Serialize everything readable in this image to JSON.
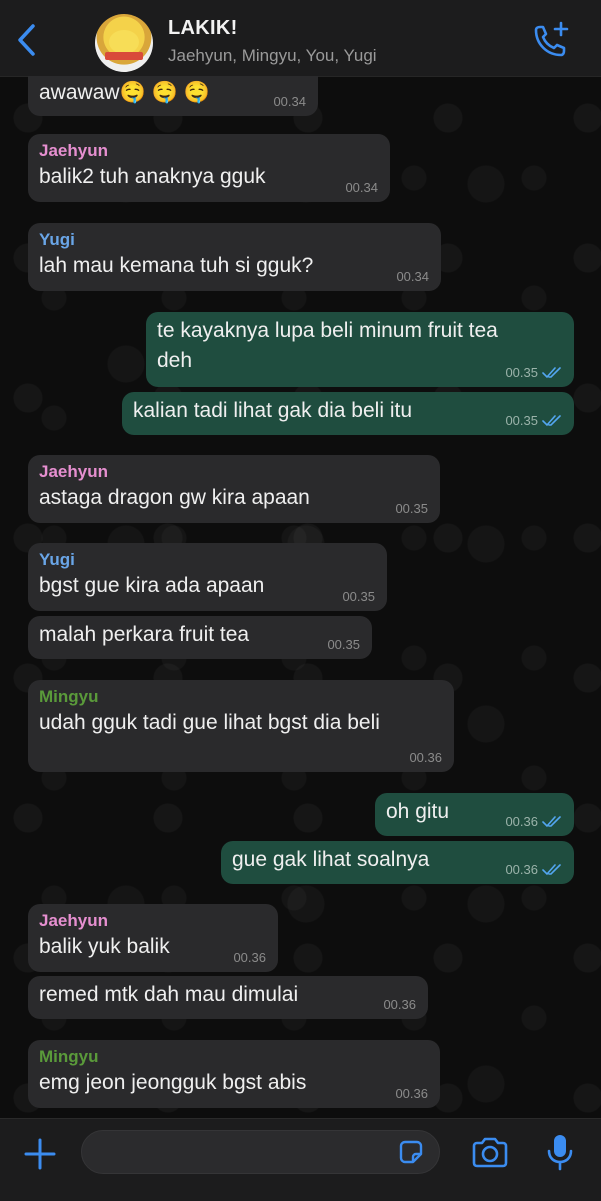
{
  "header": {
    "title": "LAKIK!",
    "members": "Jaehyun, Mingyu, You, Yugi",
    "back_icon": "chevron-left-icon",
    "call_icon": "phone-add-icon"
  },
  "colors": {
    "accent": "#3b8cf0",
    "jaehyun": "#e68fd0",
    "yugi": "#6aa6e8",
    "mingyu": "#5a9a3a",
    "outgoing_bubble": "#1f4d3f",
    "incoming_bubble": "#2a2a2c",
    "read_ticks": "#53a6f0"
  },
  "messages": [
    {
      "sender": "",
      "text": "awawaw🤤 🤤 🤤",
      "time": "00.34",
      "direction": "in"
    },
    {
      "sender": "Jaehyun",
      "text": "balik2 tuh anaknya gguk",
      "time": "00.34",
      "direction": "in"
    },
    {
      "sender": "Yugi",
      "text": "lah mau kemana tuh si gguk?",
      "time": "00.34",
      "direction": "in"
    },
    {
      "sender": "",
      "text_line1": "te kayaknya lupa beli minum fruit tea",
      "text_line2": "deh",
      "time": "00.35",
      "direction": "out"
    },
    {
      "sender": "",
      "text": "kalian tadi lihat gak dia beli itu",
      "time": "00.35",
      "direction": "out"
    },
    {
      "sender": "Jaehyun",
      "text": "astaga dragon gw kira apaan",
      "time": "00.35",
      "direction": "in"
    },
    {
      "sender": "Yugi",
      "text": "bgst gue kira ada apaan",
      "time": "00.35",
      "direction": "in"
    },
    {
      "sender": "",
      "text": "malah perkara fruit tea",
      "time": "00.35",
      "direction": "in"
    },
    {
      "sender": "Mingyu",
      "text": "udah gguk tadi gue lihat bgst dia beli",
      "time": "00.36",
      "direction": "in"
    },
    {
      "sender": "",
      "text": "oh gitu",
      "time": "00.36",
      "direction": "out"
    },
    {
      "sender": "",
      "text": "gue gak lihat soalnya",
      "time": "00.36",
      "direction": "out"
    },
    {
      "sender": "Jaehyun",
      "text": "balik yuk balik",
      "time": "00.36",
      "direction": "in"
    },
    {
      "sender": "",
      "text": "remed mtk dah mau dimulai",
      "time": "00.36",
      "direction": "in"
    },
    {
      "sender": "Mingyu",
      "text": "emg jeon jeongguk bgst abis",
      "time": "00.36",
      "direction": "in"
    }
  ],
  "footer": {
    "input_placeholder": "",
    "plus_icon": "plus-icon",
    "sticker_icon": "sticker-icon",
    "camera_icon": "camera-icon",
    "mic_icon": "microphone-icon"
  }
}
